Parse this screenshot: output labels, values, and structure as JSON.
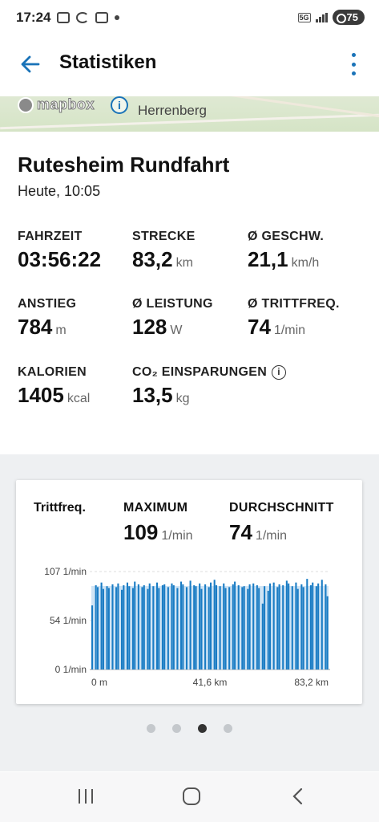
{
  "status_bar": {
    "time": "17:24",
    "network": "5G",
    "battery": "75"
  },
  "header": {
    "title": "Statistiken",
    "back_icon": "arrow-left-icon",
    "menu_icon": "more-vertical-icon"
  },
  "map": {
    "attribution": "mapbox",
    "place_label": "Herrenberg",
    "info_icon": "info-icon"
  },
  "trip": {
    "name": "Rutesheim Rundfahrt",
    "date": "Heute, 10:05"
  },
  "stats": [
    {
      "label": "FAHRZEIT",
      "value": "03:56:22",
      "unit": ""
    },
    {
      "label": "STRECKE",
      "value": "83,2",
      "unit": "km"
    },
    {
      "label": "Ø GESCHW.",
      "value": "21,1",
      "unit": "km/h"
    },
    {
      "label": "ANSTIEG",
      "value": "784",
      "unit": "m"
    },
    {
      "label": "Ø LEISTUNG",
      "value": "128",
      "unit": "W"
    },
    {
      "label": "Ø TRITTFREQ.",
      "value": "74",
      "unit": "1/min"
    },
    {
      "label": "KALORIEN",
      "value": "1405",
      "unit": "kcal"
    },
    {
      "label": "CO₂ EINSPARUNGEN",
      "value": "13,5",
      "unit": "kg"
    }
  ],
  "card": {
    "title": "Trittfreq.",
    "max_label": "MAXIMUM",
    "max_value": "109",
    "max_unit": "1/min",
    "avg_label": "DURCHSCHNITT",
    "avg_value": "74",
    "avg_unit": "1/min"
  },
  "chart_data": {
    "type": "bar",
    "title": "Trittfreq.",
    "x_ticks": [
      "0 m",
      "41,6 km",
      "83,2 km"
    ],
    "y_ticks": [
      "107 1/min",
      "54 1/min",
      "0 1/min"
    ],
    "x_range_km": [
      0,
      83.2
    ],
    "y_range": [
      0,
      107
    ],
    "series_color": "#1a7cc4",
    "values": [
      70,
      0,
      92,
      90,
      0,
      95,
      88,
      0,
      91,
      89,
      0,
      93,
      0,
      90,
      94,
      0,
      87,
      92,
      0,
      95,
      91,
      0,
      89,
      96,
      0,
      93,
      0,
      90,
      92,
      0,
      88,
      94,
      0,
      91,
      0,
      95,
      89,
      0,
      92,
      93,
      0,
      90,
      0,
      94,
      92,
      0,
      89,
      0,
      96,
      93,
      0,
      90,
      0,
      97,
      0,
      92,
      91,
      0,
      94,
      88,
      0,
      93,
      0,
      90,
      95,
      0,
      98,
      92,
      0,
      91,
      0,
      94,
      89,
      0,
      90,
      0,
      93,
      96,
      0,
      92,
      0,
      90,
      91,
      0,
      88,
      93,
      0,
      94,
      0,
      92,
      89,
      0,
      72,
      91,
      0,
      86,
      94,
      0,
      95,
      0,
      90,
      93,
      0,
      92,
      0,
      97,
      94,
      0,
      91,
      0,
      95,
      88,
      0,
      93,
      90,
      0,
      99,
      0,
      92,
      95,
      0,
      91,
      94,
      0,
      98,
      0,
      93,
      80
    ]
  },
  "pager": {
    "count": 4,
    "active_index": 2
  },
  "nav": {
    "recents_icon": "recent-apps-icon",
    "home_icon": "home-icon",
    "back_icon": "nav-back-icon"
  },
  "colors": {
    "accent": "#1a73b8",
    "chart_bar": "#1a7cc4",
    "chart_fill": "#cfe4f5",
    "section_bg": "#eef0f2"
  }
}
